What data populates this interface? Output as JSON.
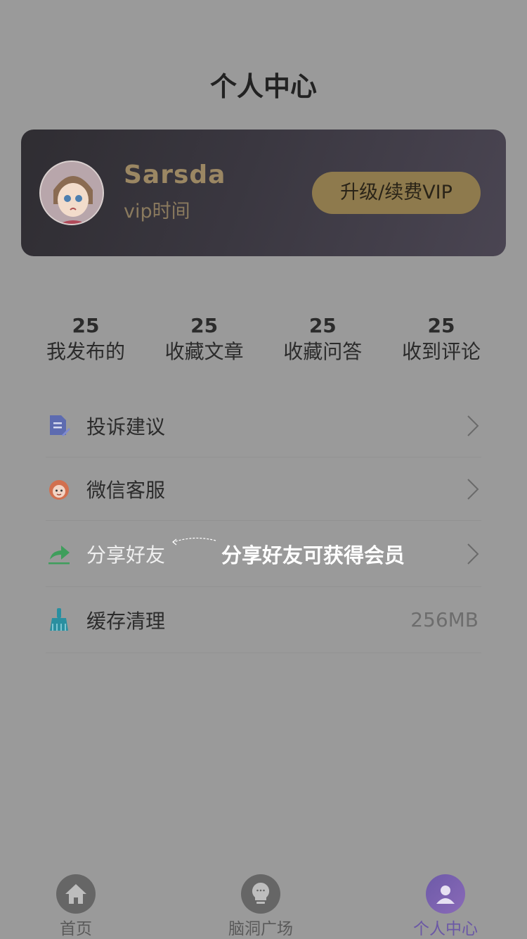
{
  "header": {
    "title": "个人中心"
  },
  "profile": {
    "name": "Sarsda",
    "vip_label": "vip时间",
    "upgrade_button": "升级/续费VIP"
  },
  "stats": [
    {
      "value": "25",
      "label": "我发布的"
    },
    {
      "value": "25",
      "label": "收藏文章"
    },
    {
      "value": "25",
      "label": "收藏问答"
    },
    {
      "value": "25",
      "label": "收到评论"
    }
  ],
  "menu": {
    "complaint": {
      "label": "投诉建议",
      "icon": "document-edit-icon"
    },
    "wechat_service": {
      "label": "微信客服",
      "icon": "customer-service-icon"
    },
    "share": {
      "label": "分享好友",
      "icon": "share-icon",
      "hint": "分享好友可获得会员"
    },
    "cache": {
      "label": "缓存清理",
      "icon": "broom-icon",
      "value": "256MB"
    }
  },
  "tabbar": {
    "home": {
      "label": "首页",
      "icon": "home-icon"
    },
    "brainstorm": {
      "label": "脑洞广场",
      "icon": "lightbulb-icon"
    },
    "profile": {
      "label": "个人中心",
      "icon": "user-icon"
    }
  },
  "colors": {
    "overlay_bg": "#9a9a9a",
    "vip_gold": "#9b8763",
    "active_tab": "#6b58a6"
  }
}
